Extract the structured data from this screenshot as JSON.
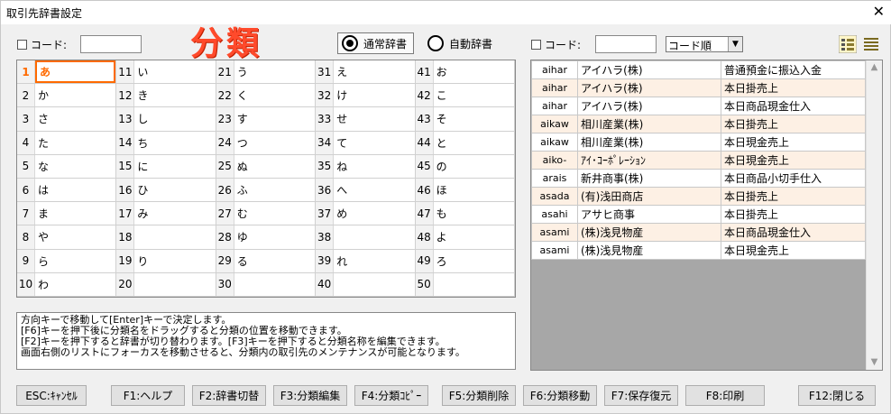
{
  "window": {
    "title": "取引先辞書設定",
    "close_symbol": "✕"
  },
  "left": {
    "code_label": "コード:",
    "code_value": ""
  },
  "heading": "分類",
  "dictionary": {
    "normal_label": "通常辞書",
    "auto_label": "自動辞書",
    "selected": "normal"
  },
  "right": {
    "code_label": "コード:",
    "code_value": "",
    "sort_value": "コード順"
  },
  "grid": [
    {
      "n": "1",
      "k": "あ"
    },
    {
      "n": "11",
      "k": "い"
    },
    {
      "n": "21",
      "k": "う"
    },
    {
      "n": "31",
      "k": "え"
    },
    {
      "n": "41",
      "k": "お"
    },
    {
      "n": "2",
      "k": "か"
    },
    {
      "n": "12",
      "k": "き"
    },
    {
      "n": "22",
      "k": "く"
    },
    {
      "n": "32",
      "k": "け"
    },
    {
      "n": "42",
      "k": "こ"
    },
    {
      "n": "3",
      "k": "さ"
    },
    {
      "n": "13",
      "k": "し"
    },
    {
      "n": "23",
      "k": "す"
    },
    {
      "n": "33",
      "k": "せ"
    },
    {
      "n": "43",
      "k": "そ"
    },
    {
      "n": "4",
      "k": "た"
    },
    {
      "n": "14",
      "k": "ち"
    },
    {
      "n": "24",
      "k": "つ"
    },
    {
      "n": "34",
      "k": "て"
    },
    {
      "n": "44",
      "k": "と"
    },
    {
      "n": "5",
      "k": "な"
    },
    {
      "n": "15",
      "k": "に"
    },
    {
      "n": "25",
      "k": "ぬ"
    },
    {
      "n": "35",
      "k": "ね"
    },
    {
      "n": "45",
      "k": "の"
    },
    {
      "n": "6",
      "k": "は"
    },
    {
      "n": "16",
      "k": "ひ"
    },
    {
      "n": "26",
      "k": "ふ"
    },
    {
      "n": "36",
      "k": "へ"
    },
    {
      "n": "46",
      "k": "ほ"
    },
    {
      "n": "7",
      "k": "ま"
    },
    {
      "n": "17",
      "k": "み"
    },
    {
      "n": "27",
      "k": "む"
    },
    {
      "n": "37",
      "k": "め"
    },
    {
      "n": "47",
      "k": "も"
    },
    {
      "n": "8",
      "k": "や"
    },
    {
      "n": "18",
      "k": ""
    },
    {
      "n": "28",
      "k": "ゆ"
    },
    {
      "n": "38",
      "k": ""
    },
    {
      "n": "48",
      "k": "よ"
    },
    {
      "n": "9",
      "k": "ら"
    },
    {
      "n": "19",
      "k": "り"
    },
    {
      "n": "29",
      "k": "る"
    },
    {
      "n": "39",
      "k": "れ"
    },
    {
      "n": "49",
      "k": "ろ"
    },
    {
      "n": "10",
      "k": "わ"
    },
    {
      "n": "20",
      "k": ""
    },
    {
      "n": "30",
      "k": ""
    },
    {
      "n": "40",
      "k": ""
    },
    {
      "n": "50",
      "k": ""
    }
  ],
  "help_lines": [
    "方向キーで移動して[Enter]キーで決定します。",
    "[F6]キーを押下後に分類名をドラッグすると分類の位置を移動できます。",
    "[F2]キーを押下すると辞書が切り替わります。[F3]キーを押下すると分類名称を編集できます。",
    "画面右側のリストにフォーカスを移動させると、分類内の取引先のメンテナンスが可能となります。"
  ],
  "rows": [
    {
      "code": "aihar",
      "name": "アイハラ(株)",
      "desc": "普通預金に振込入金"
    },
    {
      "code": "aihar",
      "name": "アイハラ(株)",
      "desc": "本日掛売上"
    },
    {
      "code": "aihar",
      "name": "アイハラ(株)",
      "desc": "本日商品現金仕入"
    },
    {
      "code": "aikaw",
      "name": "相川産業(株)",
      "desc": "本日掛売上"
    },
    {
      "code": "aikaw",
      "name": "相川産業(株)",
      "desc": "本日現金売上"
    },
    {
      "code": "aiko-",
      "name": "ｱｲ･ｺｰﾎﾟﾚｰｼｮﾝ",
      "desc": "本日現金売上"
    },
    {
      "code": "arais",
      "name": "新井商事(株)",
      "desc": "本日商品小切手仕入"
    },
    {
      "code": "asada",
      "name": "(有)浅田商店",
      "desc": "本日掛売上"
    },
    {
      "code": "asahi",
      "name": "アサヒ商事",
      "desc": "本日掛売上"
    },
    {
      "code": "asami",
      "name": "(株)浅見物産",
      "desc": "本日商品現金仕入"
    },
    {
      "code": "asami",
      "name": "(株)浅見物産",
      "desc": "本日現金売上"
    }
  ],
  "buttons": [
    {
      "label": "ESC:ｷｬﾝｾﾙ",
      "name": "esc-cancel-button"
    },
    {
      "label": "F1:ヘルプ",
      "name": "f1-help-button"
    },
    {
      "label": "F2:辞書切替",
      "name": "f2-switch-dictionary-button"
    },
    {
      "label": "F3:分類編集",
      "name": "f3-edit-category-button"
    },
    {
      "label": "F4:分類ｺﾋﾟｰ",
      "name": "f4-copy-category-button"
    },
    {
      "label": "F5:分類削除",
      "name": "f5-delete-category-button"
    },
    {
      "label": "F6:分類移動",
      "name": "f6-move-category-button"
    },
    {
      "label": "F7:保存復元",
      "name": "f7-save-restore-button"
    },
    {
      "label": "F8:印刷",
      "name": "f8-print-button"
    },
    {
      "label": "F12:閉じる",
      "name": "f12-close-button"
    }
  ],
  "colors": {
    "accent": "#ff6a00",
    "heading": "#ff4a2b",
    "row_alt": "#fdf0e4"
  }
}
